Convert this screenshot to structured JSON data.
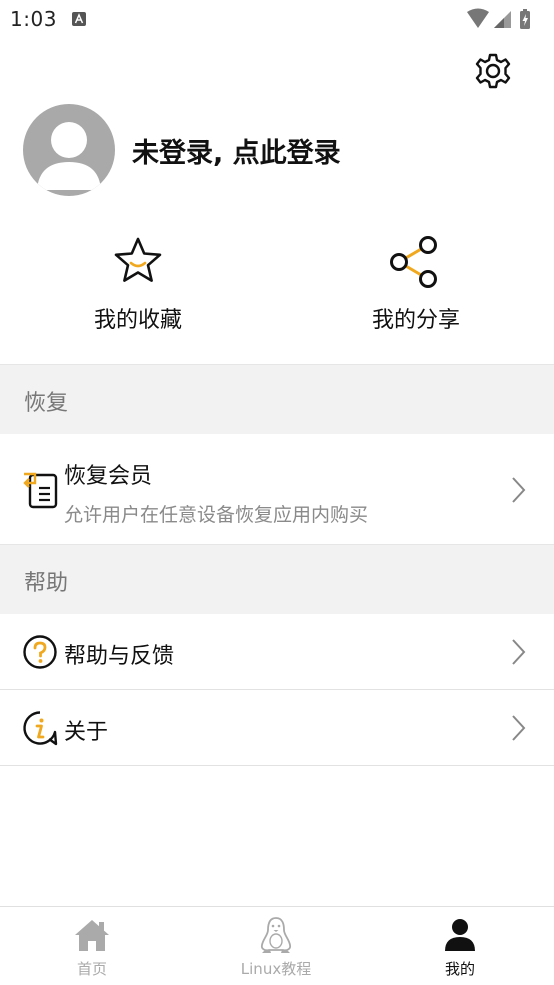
{
  "status_bar": {
    "time": "1:03"
  },
  "profile": {
    "login_prompt": "未登录, 点此登录"
  },
  "quick_actions": {
    "favorites_label": "我的收藏",
    "share_label": "我的分享"
  },
  "sections": {
    "restore": {
      "header": "恢复",
      "item_title": "恢复会员",
      "item_subtitle": "允许用户在任意设备恢复应用内购买"
    },
    "help": {
      "header": "帮助",
      "feedback_label": "帮助与反馈",
      "about_label": "关于"
    }
  },
  "bottom_nav": {
    "items": [
      {
        "label": "首页",
        "icon": "home-icon"
      },
      {
        "label": "Linux教程",
        "icon": "penguin-icon"
      },
      {
        "label": "我的",
        "icon": "person-icon"
      }
    ],
    "active_index": 2
  },
  "colors": {
    "accent": "#f0a81e",
    "section_bg": "#f2f2f2",
    "avatar_bg": "#a9a9a9",
    "inactive_nav": "#aaaaaa"
  }
}
